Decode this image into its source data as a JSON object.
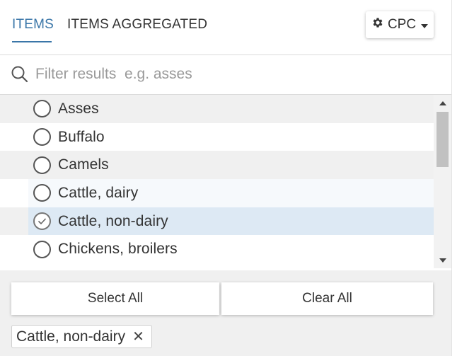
{
  "tabs": [
    {
      "label": "ITEMS"
    },
    {
      "label": "ITEMS AGGREGATED"
    }
  ],
  "settings_button": {
    "label": "CPC",
    "icon": "gear-icon"
  },
  "search": {
    "placeholder": "Filter results  e.g. asses",
    "value": ""
  },
  "items": [
    {
      "label": "Asses",
      "checked": false
    },
    {
      "label": "Buffalo",
      "checked": false
    },
    {
      "label": "Camels",
      "checked": false
    },
    {
      "label": "Cattle, dairy",
      "checked": false
    },
    {
      "label": "Cattle, non-dairy",
      "checked": true
    },
    {
      "label": "Chickens, broilers",
      "checked": false
    }
  ],
  "actions": {
    "select_all": "Select All",
    "clear_all": "Clear All"
  },
  "selected_tags": [
    {
      "label": "Cattle, non-dairy",
      "remove": "✕"
    }
  ],
  "colors": {
    "accent": "#3a76a8",
    "selected_row": "#dde9f4"
  }
}
